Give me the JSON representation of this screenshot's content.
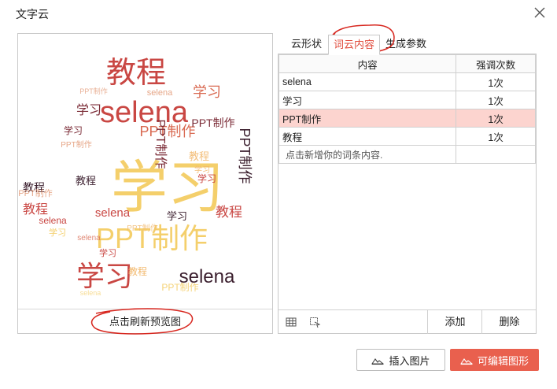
{
  "dialog": {
    "title": "文字云",
    "close_icon": "close-icon"
  },
  "preview": {
    "refresh_label": "点击刷新预览图",
    "cloud_words": [
      "教程",
      "selena",
      "学习",
      "PPT制作",
      "学习",
      "selena",
      "教程",
      "PPT制作",
      "PPT制作",
      "教程",
      "学习",
      "selena"
    ]
  },
  "tabs": [
    {
      "label": "云形状",
      "active": false
    },
    {
      "label": "词云内容",
      "active": true
    },
    {
      "label": "生成参数",
      "active": false
    }
  ],
  "table": {
    "headers": [
      "内容",
      "强调次数"
    ],
    "rows": [
      {
        "content": "selena",
        "count": "1次",
        "selected": false
      },
      {
        "content": "学习",
        "count": "1次",
        "selected": false
      },
      {
        "content": "PPT制作",
        "count": "1次",
        "selected": true
      },
      {
        "content": "教程",
        "count": "1次",
        "selected": false
      }
    ],
    "add_hint": "点击新增你的词条内容."
  },
  "toolbar": {
    "import_icon": "spreadsheet-import-icon",
    "clear_icon": "clear-format-icon",
    "add_label": "添加",
    "delete_label": "删除"
  },
  "footer": {
    "insert_label": "插入图片",
    "edit_label": "可编辑图形",
    "accent_color": "#e9604e"
  }
}
